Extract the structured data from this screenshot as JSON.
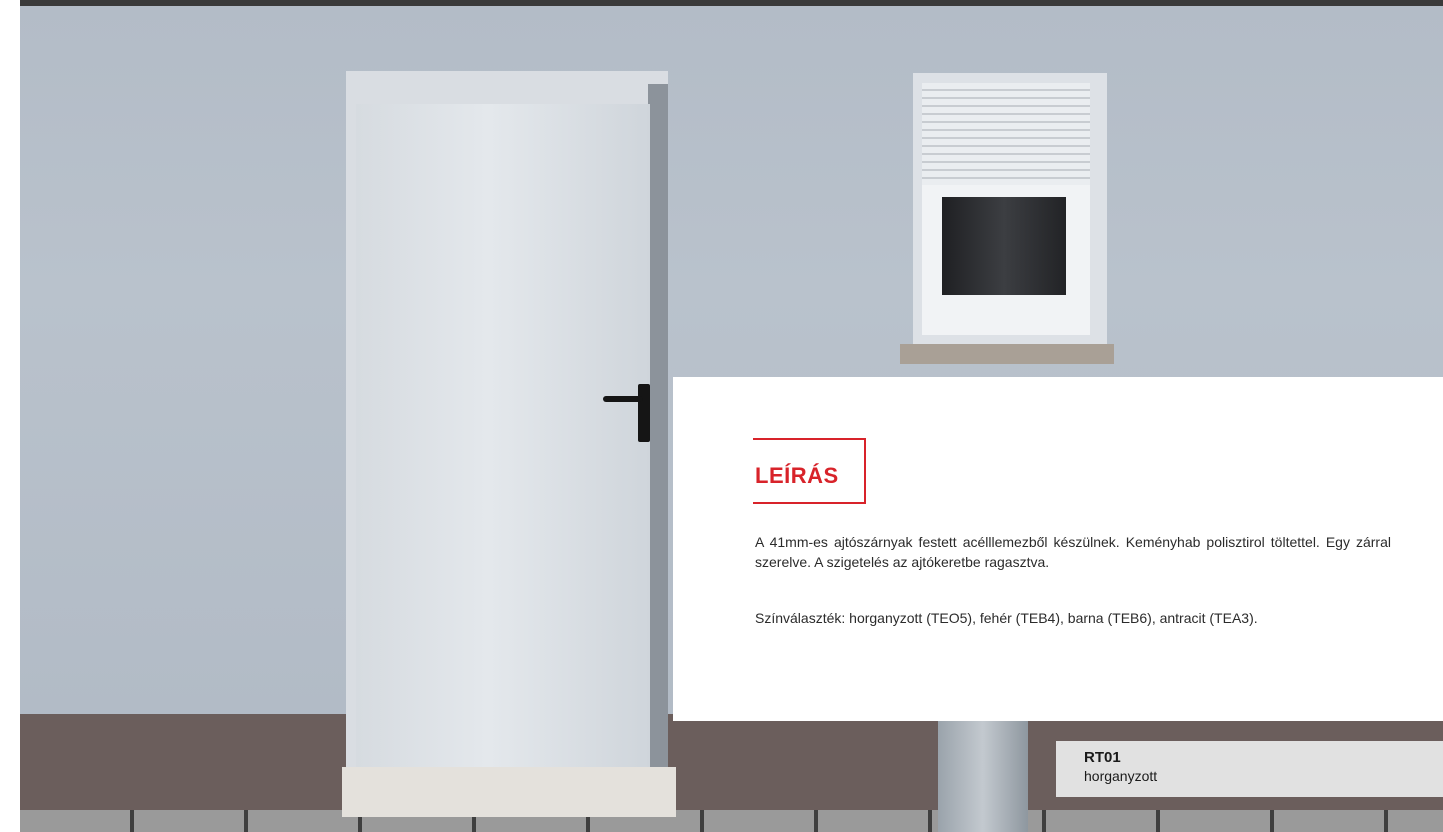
{
  "panel": {
    "title": "LEÍRÁS",
    "description": "A 41mm-es ajtószárnyak festett acélllemezből készülnek. Keményhab polisztirol töltettel. Egy zárral szerelve. A szigetelés az ajtókeretbe ragasztva.",
    "colors": "Színválaszték: horganyzott (TEO5), fehér (TEB4), barna (TEB6), antracit (TEA3)."
  },
  "label": {
    "code": "RT01",
    "name": "horganyzott"
  },
  "colors": {
    "accent": "#d8232a",
    "wall": "#b7c0ca",
    "plinth": "#6b5e5c",
    "label_bg": "#e1e1e1"
  }
}
